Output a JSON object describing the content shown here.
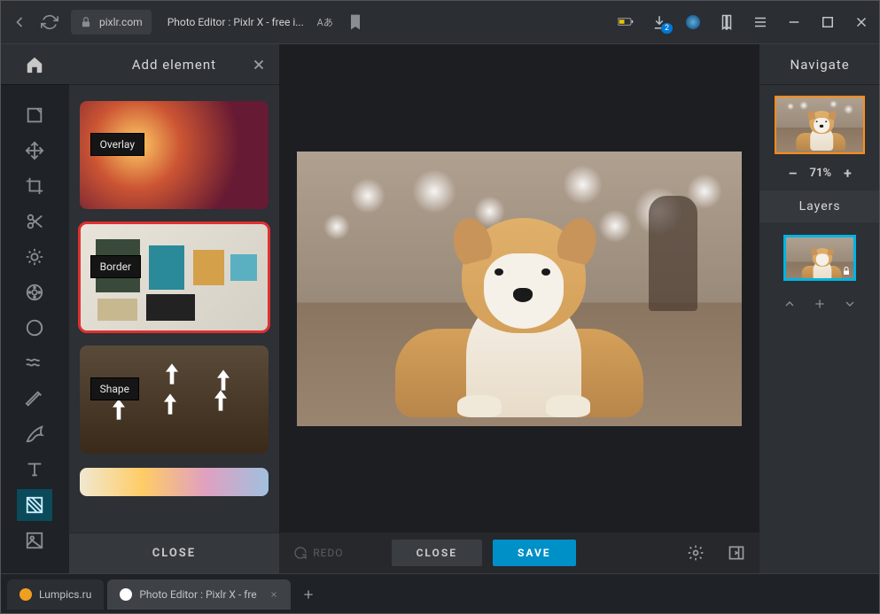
{
  "browser": {
    "url_host": "pixlr.com",
    "page_title": "Photo Editor : Pixlr X - free i...",
    "download_badge": "2"
  },
  "panel": {
    "title": "Add element",
    "categories": {
      "overlay": "Overlay",
      "border": "Border",
      "shape": "Shape"
    },
    "close_label": "CLOSE"
  },
  "canvas_footer": {
    "redo_label": "REDO",
    "close_label": "CLOSE",
    "save_label": "SAVE"
  },
  "right": {
    "navigate_title": "Navigate",
    "zoom": {
      "minus": "–",
      "value": "71%",
      "plus": "+"
    },
    "layers_title": "Layers"
  },
  "tabs": {
    "t1": "Lumpics.ru",
    "t2": "Photo Editor : Pixlr X - fre"
  }
}
